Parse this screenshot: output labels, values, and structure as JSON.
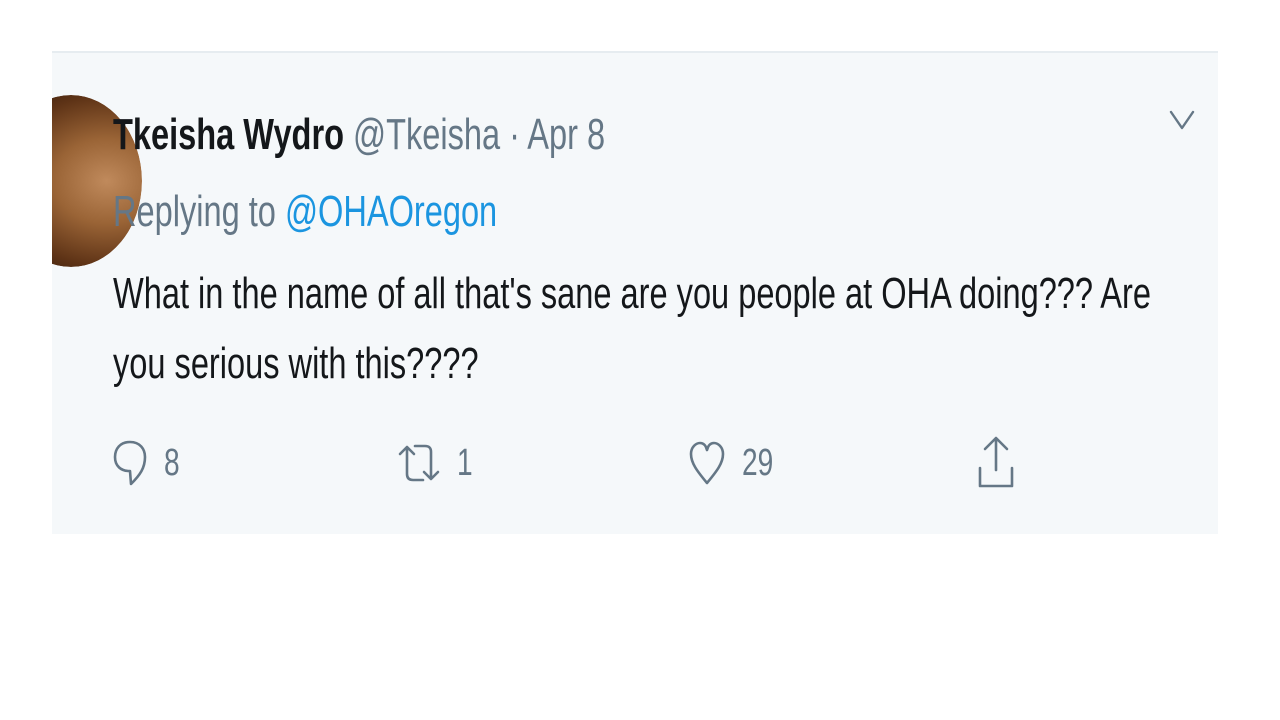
{
  "tweet": {
    "author": {
      "display_name": "Tkeisha Wydro",
      "handle": "@Tkeisha"
    },
    "separator": "·",
    "date": "Apr 8",
    "reply_prefix": "Replying to",
    "reply_to": "@OHAOregon",
    "text": "What in the name of all that's sane are you people at OHA doing???  Are you serious with this????",
    "actions": {
      "replies": "8",
      "retweets": "1",
      "likes": "29"
    }
  },
  "icons": {
    "menu": "chevron-down-icon",
    "reply": "reply-bubble-icon",
    "retweet": "retweet-icon",
    "like": "heart-icon",
    "share": "share-icon"
  },
  "colors": {
    "card_background": "#f5f8fa",
    "text": "#14171a",
    "secondary_text": "#657786",
    "link": "#1b95e0"
  }
}
